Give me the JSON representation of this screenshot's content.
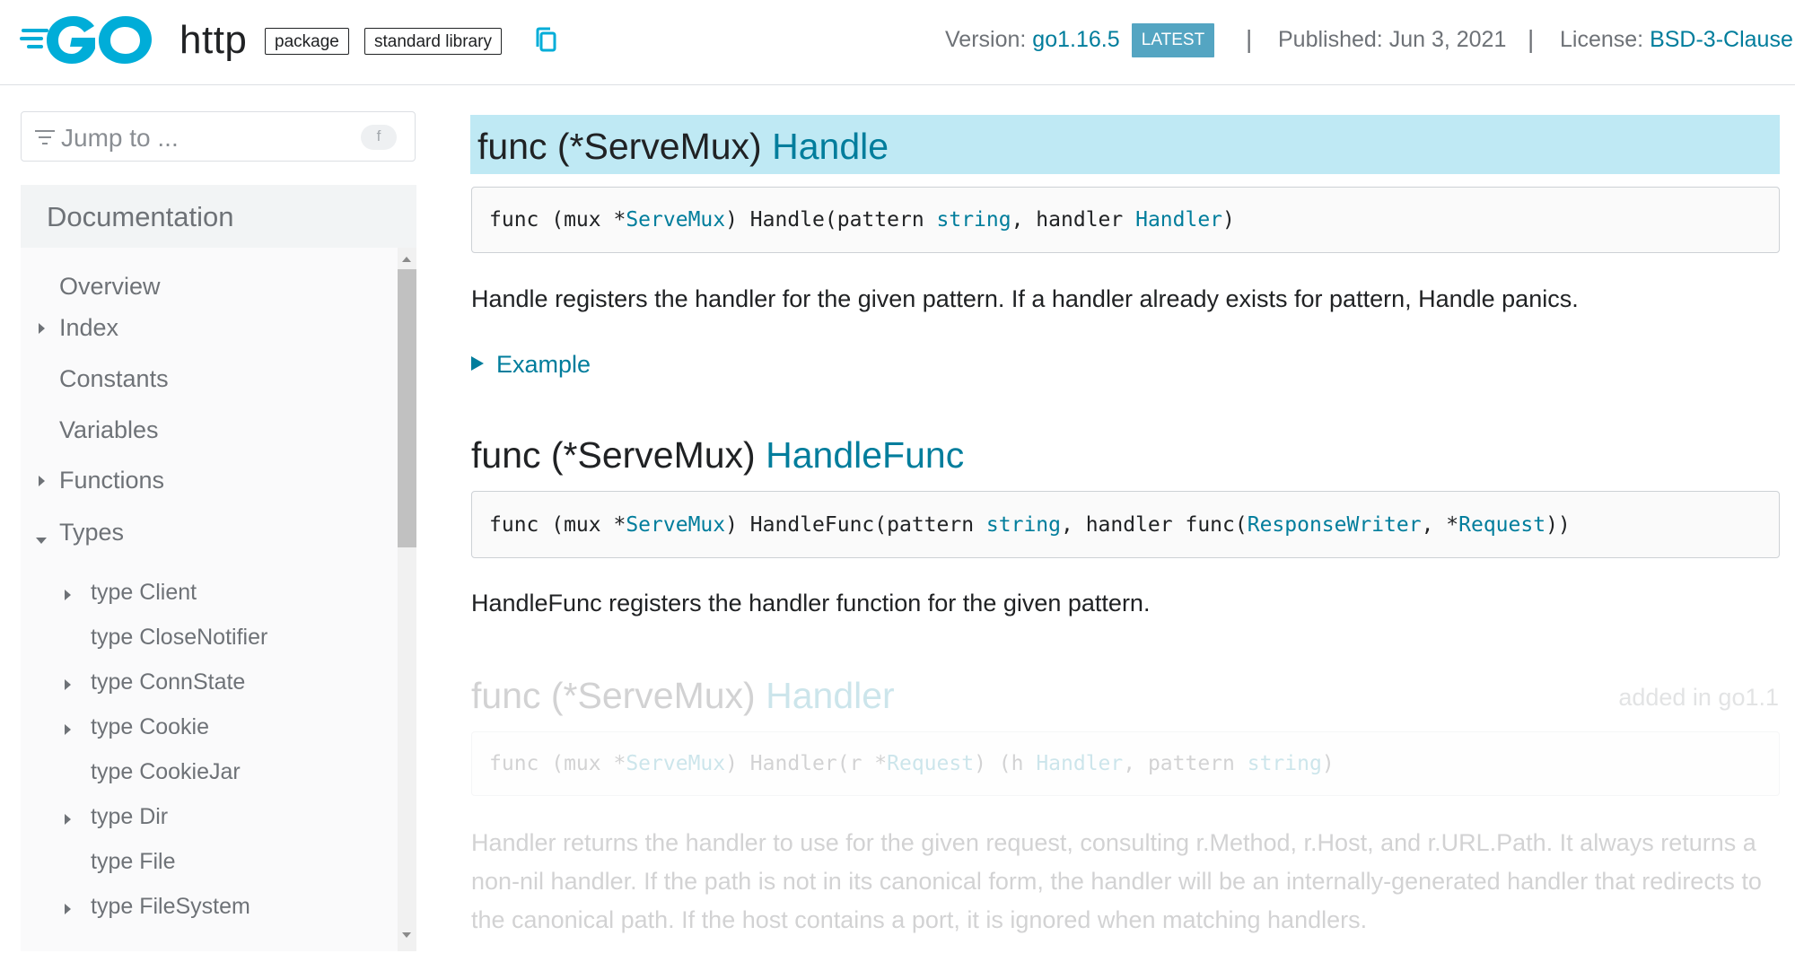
{
  "header": {
    "package_name": "http",
    "chips": [
      "package",
      "standard library"
    ],
    "version_label": "Version:",
    "version_value": "go1.16.5",
    "latest_badge": "LATEST",
    "separator": "|",
    "published": "Published: Jun 3, 2021",
    "license_label": "License:",
    "license_value": "BSD-3-Clause",
    "brand_color": "#00add8"
  },
  "sidebar": {
    "jump_placeholder": "Jump to ...",
    "jump_shortcut": "f",
    "section_title": "Documentation",
    "items": [
      {
        "label": "Overview",
        "expandable": false
      },
      {
        "label": "Index",
        "expandable": true
      },
      {
        "label": "Constants",
        "expandable": false
      },
      {
        "label": "Variables",
        "expandable": false
      },
      {
        "label": "Functions",
        "expandable": true
      },
      {
        "label": "Types",
        "expandable": true,
        "expanded": true
      }
    ],
    "type_items": [
      {
        "label": "type Client",
        "expandable": true
      },
      {
        "label": "type CloseNotifier",
        "expandable": false
      },
      {
        "label": "type ConnState",
        "expandable": true
      },
      {
        "label": "type Cookie",
        "expandable": true
      },
      {
        "label": "type CookieJar",
        "expandable": false
      },
      {
        "label": "type Dir",
        "expandable": true
      },
      {
        "label": "type File",
        "expandable": false
      },
      {
        "label": "type FileSystem",
        "expandable": true
      }
    ]
  },
  "main": {
    "sections": [
      {
        "heading_prefix": "func (*ServeMux)",
        "heading_name": "Handle",
        "code_parts": [
          "func (mux *",
          "ServeMux",
          ") Handle(pattern ",
          "string",
          ", handler ",
          "Handler",
          ")"
        ],
        "description": "Handle registers the handler for the given pattern. If a handler already exists for pattern, Handle panics.",
        "example_label": "Example"
      },
      {
        "heading_prefix": "func (*ServeMux)",
        "heading_name": "HandleFunc",
        "code_parts": [
          "func (mux *",
          "ServeMux",
          ") HandleFunc(pattern ",
          "string",
          ", handler func(",
          "ResponseWriter",
          ", *",
          "Request",
          "))"
        ],
        "description": "HandleFunc registers the handler function for the given pattern."
      },
      {
        "heading_prefix": "func (*ServeMux)",
        "heading_name": "Handler",
        "added": "added in go1.1",
        "code_parts": [
          "func (mux *",
          "ServeMux",
          ") Handler(r *",
          "Request",
          ") (h ",
          "Handler",
          ", pattern ",
          "string",
          ")"
        ],
        "description": "Handler returns the handler to use for the given request, consulting r.Method, r.Host, and r.URL.Path. It always returns a non-nil handler. If the path is not in its canonical form, the handler will be an internally-generated handler that redirects to the canonical path. If the host contains a port, it is ignored when matching handlers."
      }
    ]
  }
}
